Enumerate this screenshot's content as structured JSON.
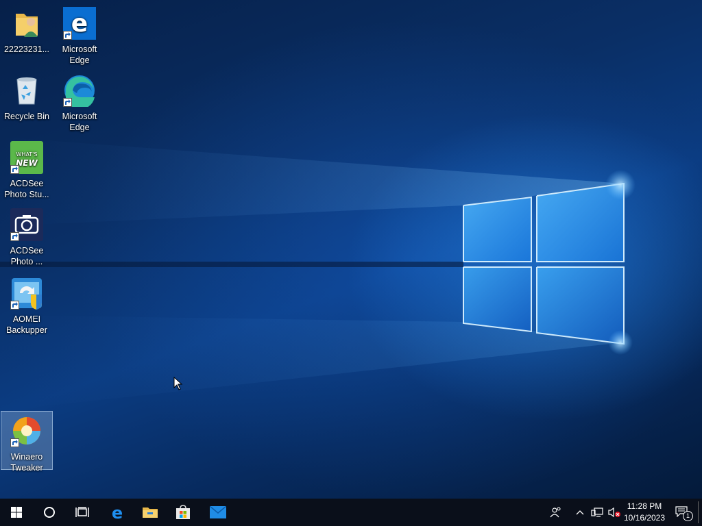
{
  "desktop": {
    "icons": [
      {
        "label": "22223231...",
        "icon": "user-folder-icon"
      },
      {
        "label": "Microsoft Edge",
        "icon": "edge-legacy-icon"
      },
      {
        "label": "Recycle Bin",
        "icon": "recycle-bin-icon"
      },
      {
        "label": "Microsoft Edge",
        "icon": "edge-chromium-icon"
      },
      {
        "label": "ACDSee Photo Stu...",
        "icon": "acdsee-whats-new-icon",
        "badge": "WHAT'S NEW"
      },
      {
        "label": "ACDSee Photo ...",
        "icon": "acdsee-camera-icon"
      },
      {
        "label": "AOMEI Backupper",
        "icon": "aomei-backupper-icon"
      },
      {
        "label": "Winaero Tweaker",
        "icon": "winaero-tweaker-icon",
        "selected": true
      }
    ]
  },
  "taskbar": {
    "buttons": [
      "start-button",
      "search-button",
      "task-view-button",
      "edge-taskbar",
      "file-explorer-taskbar",
      "store-taskbar",
      "mail-taskbar"
    ],
    "clock": {
      "time": "11:28 PM",
      "date": "10/16/2023"
    },
    "notification_count": "1"
  },
  "colors": {
    "taskbar": "#0a0f1a",
    "accent": "#1e90ff",
    "wallpaper": "#0b3c82"
  }
}
